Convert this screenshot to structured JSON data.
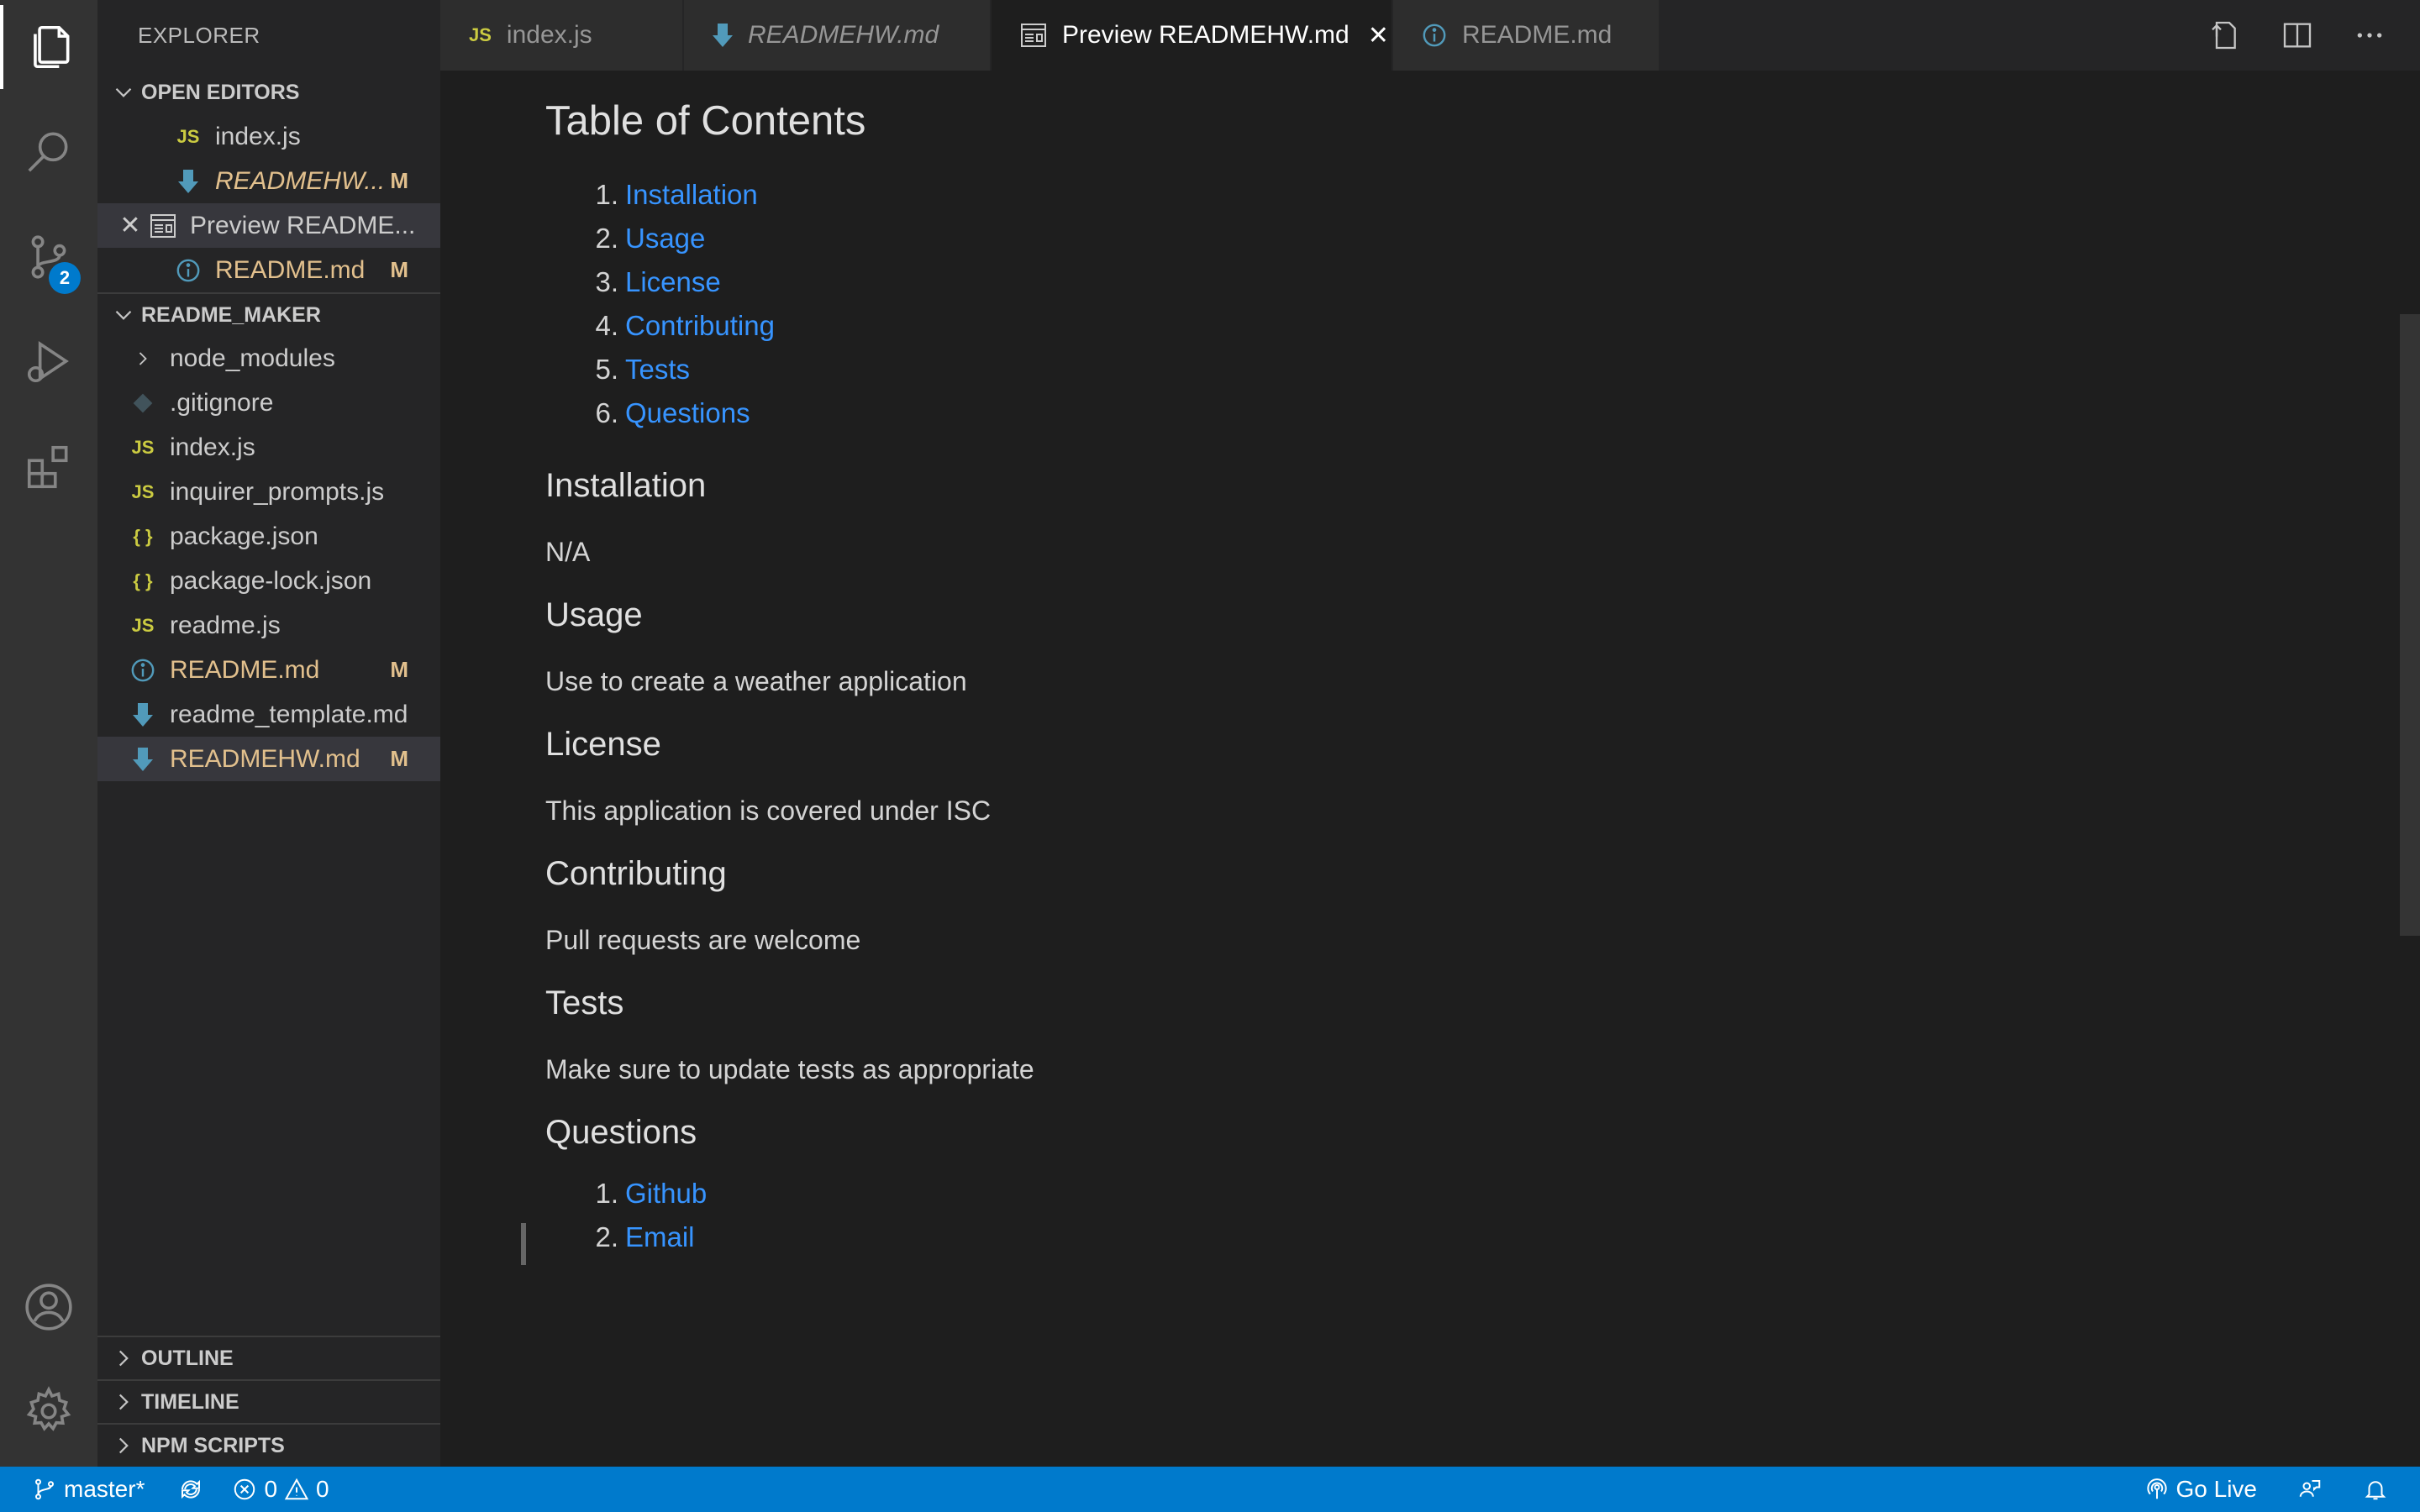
{
  "sidebar": {
    "title": "EXPLORER",
    "open_editors": {
      "header": "OPEN EDITORS",
      "items": [
        {
          "icon": "JS",
          "label": "index.js",
          "badge": ""
        },
        {
          "icon": "",
          "label": "READMEHW...",
          "badge": "M"
        },
        {
          "icon": "",
          "label": "Preview README...",
          "badge": ""
        },
        {
          "icon": "",
          "label": "README.md",
          "badge": "M"
        }
      ]
    },
    "project": {
      "header": "README_MAKER",
      "items": [
        {
          "icon": "",
          "label": "node_modules",
          "badge": ""
        },
        {
          "icon": "",
          "label": ".gitignore",
          "badge": ""
        },
        {
          "icon": "JS",
          "label": "index.js",
          "badge": ""
        },
        {
          "icon": "JS",
          "label": "inquirer_prompts.js",
          "badge": ""
        },
        {
          "icon": "{ }",
          "label": "package.json",
          "badge": ""
        },
        {
          "icon": "{ }",
          "label": "package-lock.json",
          "badge": ""
        },
        {
          "icon": "JS",
          "label": "readme.js",
          "badge": ""
        },
        {
          "icon": "",
          "label": "README.md",
          "badge": "M"
        },
        {
          "icon": "",
          "label": "readme_template.md",
          "badge": ""
        },
        {
          "icon": "",
          "label": "READMEHW.md",
          "badge": "M"
        }
      ]
    },
    "bottom_sections": [
      "OUTLINE",
      "TIMELINE",
      "NPM SCRIPTS"
    ]
  },
  "activity_bar": {
    "source_control_badge": "2"
  },
  "tabs": [
    {
      "icon": "JS",
      "label": "index.js"
    },
    {
      "icon": "",
      "label": "READMEHW.md"
    },
    {
      "icon": "",
      "label": "Preview READMEHW.md",
      "close": "✕"
    },
    {
      "icon": "",
      "label": "README.md"
    }
  ],
  "preview": {
    "toc_title": "Table of Contents",
    "toc": [
      {
        "num": "1.",
        "label": "Installation"
      },
      {
        "num": "2.",
        "label": "Usage"
      },
      {
        "num": "3.",
        "label": "License"
      },
      {
        "num": "4.",
        "label": "Contributing"
      },
      {
        "num": "5.",
        "label": "Tests"
      },
      {
        "num": "6.",
        "label": "Questions"
      }
    ],
    "sections": [
      {
        "heading": "Installation",
        "body": "N/A"
      },
      {
        "heading": "Usage",
        "body": "Use to create a weather application"
      },
      {
        "heading": "License",
        "body": "This application is covered under ISC"
      },
      {
        "heading": "Contributing",
        "body": "Pull requests are welcome"
      },
      {
        "heading": "Tests",
        "body": "Make sure to update tests as appropriate"
      }
    ],
    "questions_heading": "Questions",
    "questions": [
      {
        "num": "1.",
        "label": "Github"
      },
      {
        "num": "2.",
        "label": "Email"
      }
    ]
  },
  "status_bar": {
    "branch": "master*",
    "errors": "0",
    "warnings": "0",
    "go_live": "Go Live"
  },
  "colors": {
    "accent": "#007acc",
    "link": "#3794ff",
    "modified": "#e2c08d"
  }
}
